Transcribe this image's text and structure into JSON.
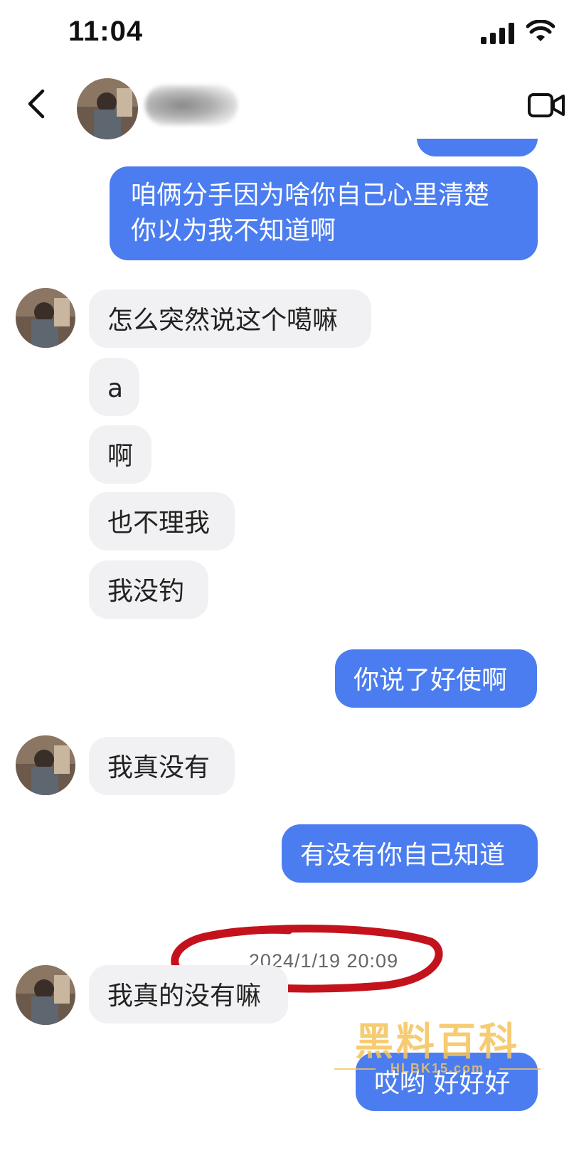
{
  "status_bar": {
    "time": "11:04"
  },
  "header": {
    "avatar_alt": "contact avatar"
  },
  "messages": [
    {
      "side": "outgoing",
      "text": "咱俩分手因为啥你自己心里清楚\n你以为我不知道啊"
    },
    {
      "side": "incoming",
      "text": "怎么突然说这个噶嘛"
    },
    {
      "side": "incoming",
      "text": "a"
    },
    {
      "side": "incoming",
      "text": "啊"
    },
    {
      "side": "incoming",
      "text": "也不理我"
    },
    {
      "side": "incoming",
      "text": "我没钓"
    },
    {
      "side": "outgoing",
      "text": "你说了好使啊"
    },
    {
      "side": "incoming",
      "text": "我真没有"
    },
    {
      "side": "outgoing",
      "text": "有没有你自己知道"
    },
    {
      "side": "incoming",
      "text": "我真的没有嘛"
    },
    {
      "side": "outgoing",
      "text": "哎哟 好好好"
    }
  ],
  "timestamp": "2024/1/19 20:09",
  "watermark": {
    "logo": "黑料百科",
    "url": "HLBK15.com"
  },
  "colors": {
    "outgoing_bubble": "#4b7df0",
    "incoming_bubble": "#f1f1f3",
    "annotation_circle": "#c4121c",
    "watermark": "#f5c35a"
  }
}
